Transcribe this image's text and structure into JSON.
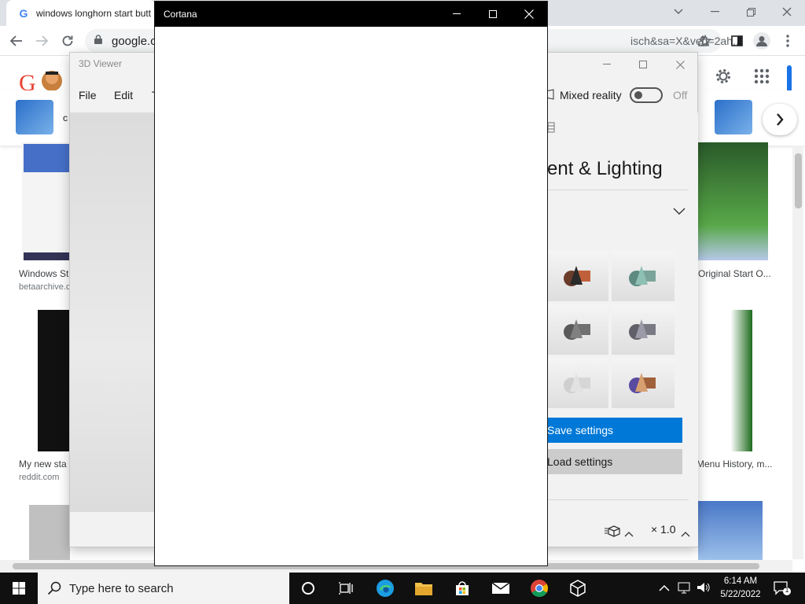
{
  "chrome": {
    "tab_title": "windows longhorn start butt",
    "url_main": "google.c",
    "url_tail": "isch&sa=X&ved=2ah...",
    "minimize_icon": "chevron-down-icon"
  },
  "results": {
    "col1": [
      {
        "title": "Windows St",
        "source": "betaarchive.c"
      },
      {
        "title": "My new sta",
        "source": "reddit.com"
      }
    ],
    "col4": [
      {
        "title": "Original Start O..."
      },
      {
        "title": "Menu History, m..."
      }
    ]
  },
  "viewer": {
    "title": "3D Viewer",
    "menu": [
      "File",
      "Edit",
      "T"
    ],
    "mixed_reality_label": "Mixed reality",
    "mixed_reality_state": "Off",
    "section_title": "ent & Lighting",
    "save_button": "Save settings",
    "load_button": "Load settings",
    "zoom": "× 1.0"
  },
  "cortana": {
    "title": "Cortana"
  },
  "taskbar": {
    "search_placeholder": "Type here to search",
    "time": "6:14 AM",
    "date": "5/22/2022",
    "notification_count": "1"
  },
  "colors": {
    "accent": "#0078d7",
    "taskbar": "#101010"
  }
}
